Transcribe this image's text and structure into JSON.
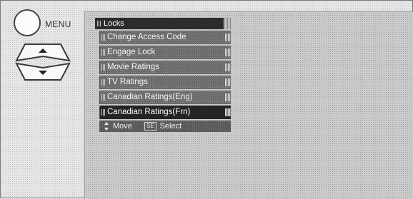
{
  "remote": {
    "menu_label": "MENU"
  },
  "osd": {
    "title": "Locks",
    "items": [
      {
        "label": "Change Access Code",
        "selected": false
      },
      {
        "label": "Engage Lock",
        "selected": false
      },
      {
        "label": "Movie Ratings",
        "selected": false
      },
      {
        "label": "TV Ratings",
        "selected": false
      },
      {
        "label": "Canadian Ratings(Eng)",
        "selected": false
      },
      {
        "label": "Canadian Ratings(Frn)",
        "selected": true
      }
    ],
    "footer": {
      "move_label": "Move",
      "select_key": "SE",
      "select_label": "Select"
    }
  }
}
